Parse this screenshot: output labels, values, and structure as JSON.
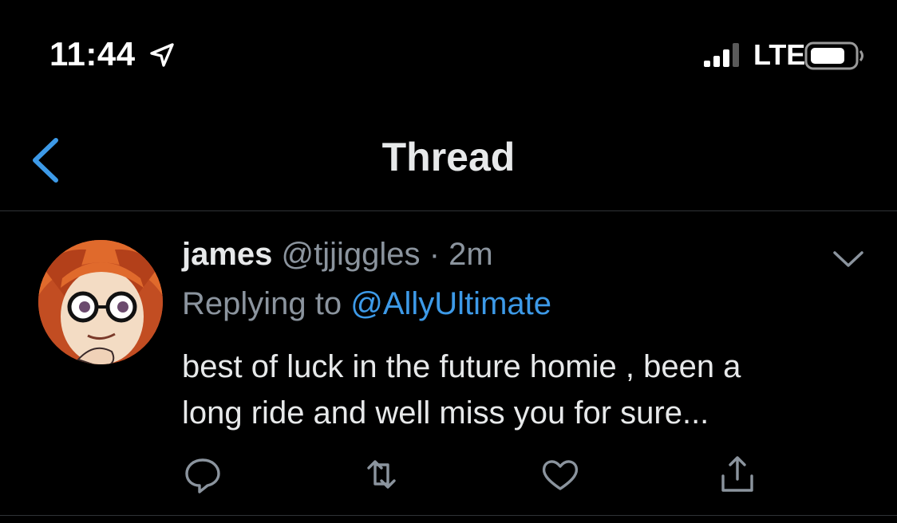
{
  "status_bar": {
    "time": "11:44",
    "network": "LTE",
    "location_icon": "location-arrow-icon",
    "signal_icon": "cellular-signal-icon",
    "battery_icon": "battery-icon"
  },
  "nav": {
    "back_icon": "chevron-left-icon",
    "title": "Thread"
  },
  "tweet": {
    "name": "james",
    "handle": "@tjjiggles",
    "separator": "·",
    "time": "2m",
    "replying_prefix": "Replying to ",
    "replying_to": "@AllyUltimate",
    "text_line1": "best of luck in the future homie , been a",
    "text_line2": "long ride and well miss you for sure...",
    "actions": [
      "reply-icon",
      "retweet-icon",
      "like-icon",
      "share-icon"
    ]
  },
  "colors": {
    "background": "#000000",
    "accent": "#3d9ae8",
    "secondary_text": "#8b949e",
    "primary_text": "#e7e9ea",
    "divider": "#2f3336"
  }
}
